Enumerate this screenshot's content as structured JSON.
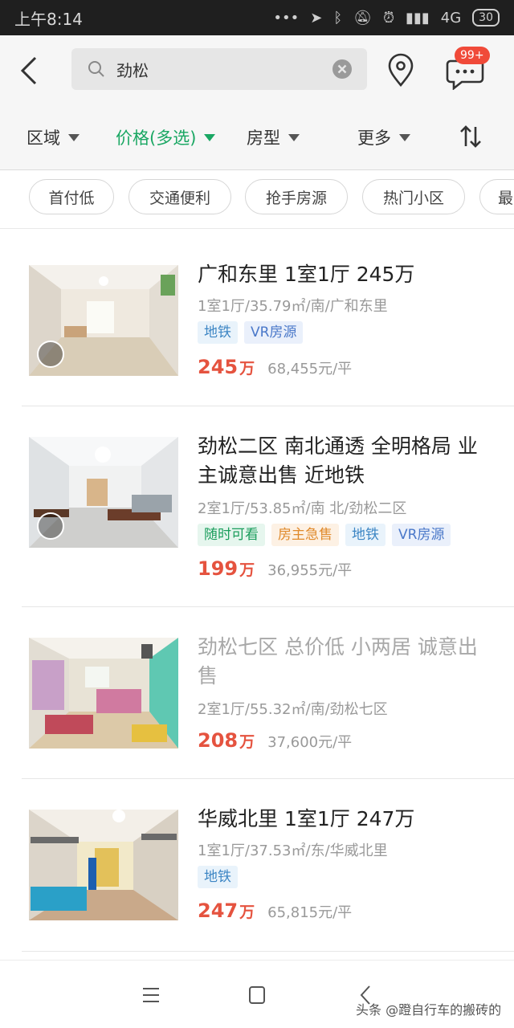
{
  "status_bar": {
    "time": "上午8:14",
    "network": "4G",
    "battery": "30"
  },
  "search": {
    "query": "劲松",
    "message_badge": "99+"
  },
  "filters": [
    {
      "label": "区域",
      "active": false
    },
    {
      "label": "价格(多选)",
      "active": true
    },
    {
      "label": "房型",
      "active": false
    },
    {
      "label": "更多",
      "active": false
    }
  ],
  "quick_tags": [
    "首付低",
    "交通便利",
    "抢手房源",
    "热门小区",
    "最"
  ],
  "listings": [
    {
      "title": "广和东里 1室1厅 245万",
      "meta": "1室1厅/35.79㎡/南/广和东里",
      "tags": [
        {
          "text": "地铁",
          "kind": "metro"
        },
        {
          "text": "VR房源",
          "kind": "vr"
        }
      ],
      "price": "245",
      "price_unit": "万",
      "unit_price": "68,455元/平",
      "visited": false
    },
    {
      "title": "劲松二区 南北通透 全明格局 业主诚意出售 近地铁",
      "meta": "2室1厅/53.85㎡/南 北/劲松二区",
      "tags": [
        {
          "text": "随时可看",
          "kind": "anytime"
        },
        {
          "text": "房主急售",
          "kind": "urgent"
        },
        {
          "text": "地铁",
          "kind": "metro"
        },
        {
          "text": "VR房源",
          "kind": "vr"
        }
      ],
      "price": "199",
      "price_unit": "万",
      "unit_price": "36,955元/平",
      "visited": false
    },
    {
      "title": "劲松七区 总价低 小两居 诚意出售",
      "meta": "2室1厅/55.32㎡/南/劲松七区",
      "tags": [],
      "price": "208",
      "price_unit": "万",
      "unit_price": "37,600元/平",
      "visited": true
    },
    {
      "title": "华威北里 1室1厅 247万",
      "meta": "1室1厅/37.53㎡/东/华威北里",
      "tags": [
        {
          "text": "地铁",
          "kind": "metro"
        }
      ],
      "price": "247",
      "price_unit": "万",
      "unit_price": "65,815元/平",
      "visited": false
    }
  ],
  "watermark": "头条 @蹬自行车的搬砖的",
  "colors": {
    "accent": "#1aa763",
    "price": "#e5533f",
    "badge": "#f04a39"
  }
}
